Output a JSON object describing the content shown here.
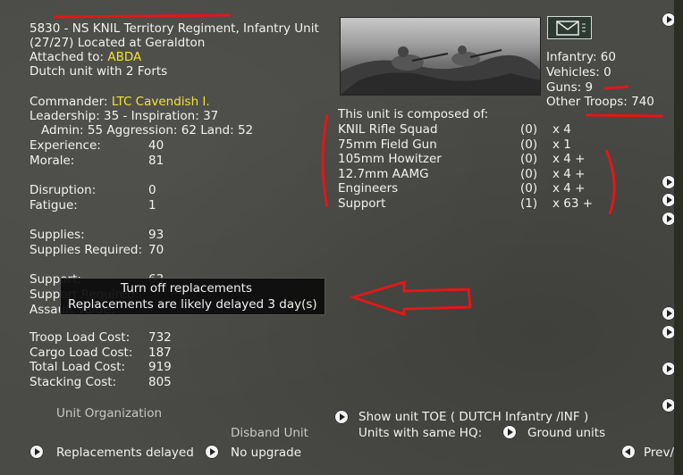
{
  "unit": {
    "title_line1": "5830 - NS KNIL Territory Regiment, Infantry Unit",
    "title_line2": "(27/27) Located at  Geraldton",
    "attached_prefix": "Attached to: ",
    "attached_value": "ABDA",
    "description": "Dutch unit with 2 Forts"
  },
  "leadership": {
    "commander_prefix": "Commander: ",
    "commander_value": "LTC Cavendish I.",
    "line1": "Leadership: 35 - Inspiration: 37",
    "line2": "Admin: 55  Aggression: 62  Land: 52"
  },
  "stats": {
    "experience_label": "Experience:",
    "experience_value": "40",
    "morale_label": "Morale:",
    "morale_value": "81",
    "disruption_label": "Disruption:",
    "disruption_value": "0",
    "fatigue_label": "Fatigue:",
    "fatigue_value": "1",
    "supplies_label": "Supplies:",
    "supplies_value": "93",
    "supplies_req_label": "Supplies Required:",
    "supplies_req_value": "70",
    "support_label": "Support:",
    "support_value": "63",
    "support_req_label": "Support Required:",
    "assault_label": "Assault Value:"
  },
  "load": {
    "troop_label": "Troop Load Cost:",
    "troop_value": "732",
    "cargo_label": "Cargo Load Cost:",
    "cargo_value": "187",
    "total_label": "Total Load Cost:",
    "total_value": "919",
    "stacking_label": "Stacking Cost:",
    "stacking_value": "805"
  },
  "tooltip": {
    "line1": "Turn off replacements",
    "line2": "Replacements are likely delayed 3 day(s)"
  },
  "summary": {
    "infantry": "Infantry: 60",
    "vehicles": "Vehicles: 0",
    "guns": "Guns: 9",
    "other": "Other Troops: 740"
  },
  "composition": {
    "header": "This unit is composed of:",
    "items": [
      {
        "name": "KNIL Rifle Squad",
        "q": "(0)",
        "count": "x 4"
      },
      {
        "name": "75mm Field Gun",
        "q": "(0)",
        "count": "x 1"
      },
      {
        "name": "105mm Howitzer",
        "q": "(0)",
        "count": "x 4 +"
      },
      {
        "name": "12.7mm AAMG",
        "q": "(0)",
        "count": "x 4 +"
      },
      {
        "name": "Engineers",
        "q": "(0)",
        "count": "x 4 +"
      },
      {
        "name": "Support",
        "q": "(1)",
        "count": "x 63 +"
      }
    ]
  },
  "bottom": {
    "unit_org": "Unit Organization",
    "disband": "Disband Unit",
    "replacements": "Replacements delayed",
    "upgrade": "No upgrade",
    "show_toe": "Show unit TOE ( DUTCH Infantry /INF )",
    "same_hq_label": "Units with same HQ:",
    "ground_units": "Ground units",
    "prev": "Prev/N"
  },
  "colors": {
    "text": "#f2f2f2",
    "highlight": "#f2e23a",
    "annotation": "#e01818",
    "panel": "#4a4a46"
  },
  "icons": [
    "mail-icon",
    "arrow-right-icon",
    "arrow-left-icon",
    "unit-photo"
  ]
}
